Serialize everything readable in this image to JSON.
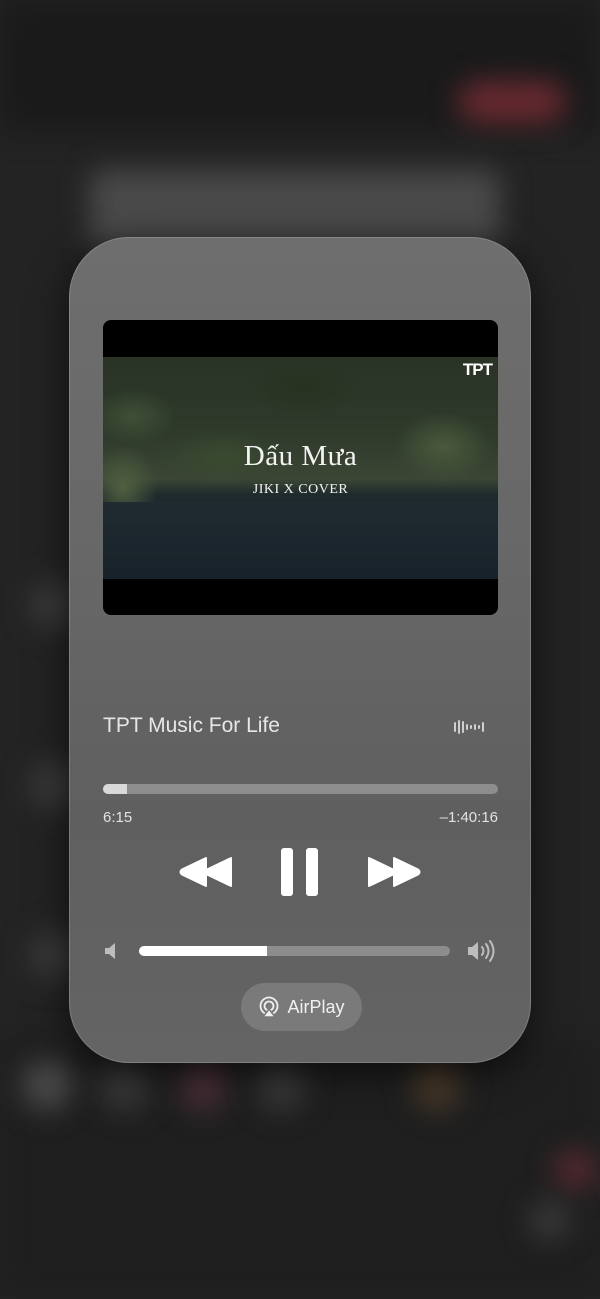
{
  "video": {
    "channel_logo": "TPT",
    "song_title": "Dấu Mưa",
    "artist_line": "JIKI X COVER"
  },
  "now_playing": {
    "title": "TPT Music For Life",
    "elapsed": "6:15",
    "remaining": "–1:40:16",
    "progress_fraction": 0.06
  },
  "controls": {
    "rewind_icon": "backward-icon",
    "pause_icon": "pause-icon",
    "forward_icon": "forward-icon"
  },
  "volume": {
    "level_fraction": 0.41
  },
  "airplay": {
    "label": "AirPlay",
    "icon": "airplay-icon"
  }
}
